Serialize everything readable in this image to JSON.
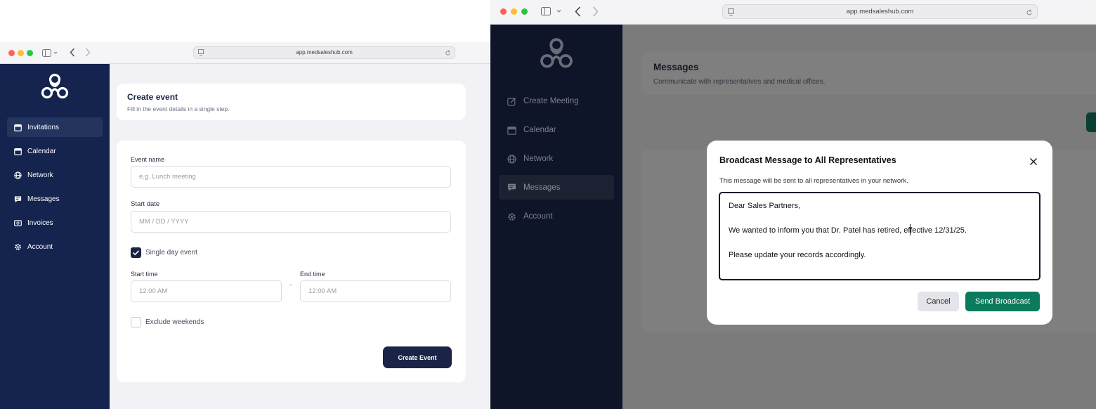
{
  "left_window": {
    "url": "app.medsaleshub.com",
    "sidebar": {
      "items": [
        {
          "label": "Invitations",
          "icon": "calendar-icon",
          "active": true
        },
        {
          "label": "Calendar",
          "icon": "calendar-icon",
          "active": false
        },
        {
          "label": "Network",
          "icon": "globe-icon",
          "active": false
        },
        {
          "label": "Messages",
          "icon": "chat-icon",
          "active": false
        },
        {
          "label": "Invoices",
          "icon": "invoice-icon",
          "active": false
        },
        {
          "label": "Account",
          "icon": "gear-icon",
          "active": false
        }
      ]
    },
    "header": {
      "title": "Create event",
      "subtitle": "Fill in the event details in a single step."
    },
    "form": {
      "event_name_label": "Event name",
      "event_name_placeholder": "e.g. Lunch meeting",
      "start_date_label": "Start date",
      "start_date_placeholder": "MM / DD / YYYY",
      "single_day_label": "Single day event",
      "single_day_checked": true,
      "start_time_label": "Start time",
      "start_time_value": "12:00 AM",
      "time_separator": "–",
      "end_time_label": "End time",
      "end_time_value": "12:00 AM",
      "exclude_weekends_label": "Exclude weekends",
      "exclude_weekends_checked": false,
      "submit_label": "Create Event"
    }
  },
  "right_window": {
    "url": "app.medsaleshub.com",
    "sidebar": {
      "items": [
        {
          "label": "Create Meeting",
          "icon": "edit-icon",
          "active": false
        },
        {
          "label": "Calendar",
          "icon": "calendar-icon",
          "active": false
        },
        {
          "label": "Network",
          "icon": "globe-icon",
          "active": false
        },
        {
          "label": "Messages",
          "icon": "chat-icon",
          "active": true
        },
        {
          "label": "Account",
          "icon": "gear-icon",
          "active": false
        }
      ]
    },
    "header": {
      "title": "Messages",
      "subtitle": "Communicate with representatives and medical offices."
    },
    "modal": {
      "title": "Broadcast Message to All Representatives",
      "description": "This message will be sent to all representatives in your network.",
      "message_lines": [
        "Dear Sales Partners,",
        "We wanted to inform you that Dr. Patel has retired, effective 12/31/25.",
        "Please update your records accordingly."
      ],
      "cancel_label": "Cancel",
      "send_label": "Send Broadcast"
    }
  },
  "colors": {
    "left_sidebar": "#14244f",
    "left_primary_button": "#1b2447",
    "right_sidebar": "#0f1528",
    "send_button": "#0b7a5d",
    "cancel_button": "#e4e5ea"
  }
}
